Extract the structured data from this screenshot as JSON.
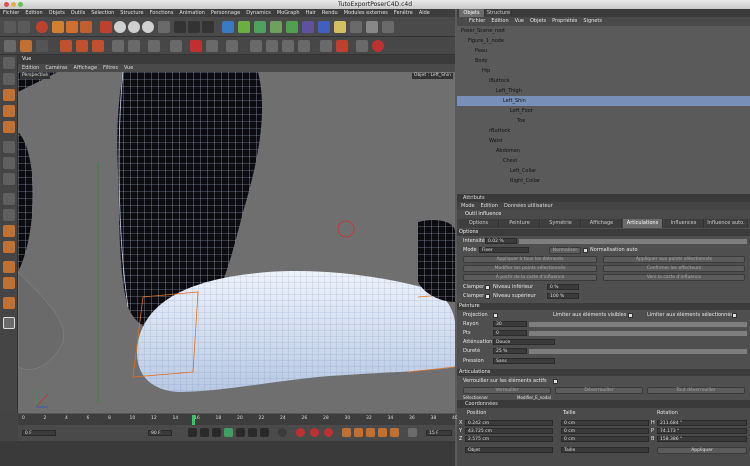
{
  "window": {
    "title": "TutoExportPoserC4D.c4d"
  },
  "menubar": [
    "Fichier",
    "Edition",
    "Objets",
    "Outils",
    "Sélection",
    "Structure",
    "Fonctions",
    "Animation",
    "Personnage",
    "Dynamics",
    "MoGraph",
    "Hair",
    "Rendu",
    "Modules externes",
    "Fenêtre",
    "Aide"
  ],
  "viewport": {
    "panel_title": "Vue",
    "menu": [
      "Edition",
      "Caméras",
      "Affichage",
      "Filtres",
      "Vue"
    ],
    "camera_label": "Perspective",
    "object_tag": "Objet : Left_Shin"
  },
  "timeline": {
    "ticks": [
      "0",
      "2",
      "4",
      "6",
      "8",
      "10",
      "12",
      "14",
      "16",
      "18",
      "20",
      "22",
      "24",
      "26",
      "28",
      "30",
      "32",
      "34",
      "36",
      "38",
      "40"
    ]
  },
  "playbar": {
    "start": "0 F",
    "end": "90 F",
    "current": "15 F"
  },
  "objects": {
    "tabs": [
      "Objets",
      "Structure"
    ],
    "menu": [
      "Fichier",
      "Edition",
      "Vue",
      "Objets",
      "Propriétés",
      "Signets"
    ],
    "tree": [
      {
        "name": "Poser_Scene_root",
        "indent": 0
      },
      {
        "name": "Figure_1_node",
        "indent": 1
      },
      {
        "name": "Peau",
        "indent": 2
      },
      {
        "name": "Body",
        "indent": 2
      },
      {
        "name": "Hip",
        "indent": 3
      },
      {
        "name": "lButtock",
        "indent": 4
      },
      {
        "name": "Left_Thigh",
        "indent": 5
      },
      {
        "name": "Left_Shin",
        "indent": 6
      },
      {
        "name": "Left_Foot",
        "indent": 7
      },
      {
        "name": "Toe",
        "indent": 8
      },
      {
        "name": "rButtock",
        "indent": 4
      },
      {
        "name": "Waist",
        "indent": 4
      },
      {
        "name": "Abdomen",
        "indent": 5
      },
      {
        "name": "Chest",
        "indent": 6
      },
      {
        "name": "Left_Collar",
        "indent": 7
      },
      {
        "name": "Right_Collar",
        "indent": 7
      }
    ]
  },
  "attributes": {
    "header": "Attributs",
    "menu": [
      "Mode",
      "Edition",
      "Données utilisateur"
    ],
    "title": "Outil influence",
    "tabs": [
      "Options",
      "Peinture",
      "Symétrie",
      "Affichage",
      "Articulations",
      "Influences",
      "Influence auto."
    ],
    "active_tab": "Articulations",
    "section_options": "Options",
    "intensity_label": "Intensité",
    "intensity_value": "0.02 %",
    "mode_label": "Mode",
    "mode_value": "Fixer",
    "normalize_btn": "Normaliser",
    "normalize_auto": "Normalisation auto",
    "btn_apply_all": "Appliquer à tous les éléments",
    "btn_apply_sel": "Appliquer aux points sélectionnés",
    "btn_modify": "Modifier les points sélectionnés",
    "btn_confirm": "Confirmer les effecteurs",
    "btn_from_map": "À partir de la carte d'influence",
    "btn_to_map": "Vers la carte d'influence",
    "clamp1_label": "Clamper",
    "clamp1_sub": "Niveau inférieur",
    "clamp1_value": "0 %",
    "clamp2_label": "Clamper",
    "clamp2_sub": "Niveau supérieur",
    "clamp2_value": "100 %",
    "section_paint": "Peinture",
    "projection_label": "Projection",
    "limit_visible": "Limiter aux éléments visibles",
    "limit_selected": "Limiter aux éléments sélectionnés",
    "rayon_label": "Rayon",
    "rayon_value": "30",
    "pts_label": "Pts",
    "pts_value": "0",
    "atten_label": "Atténuation",
    "atten_value": "Douce",
    "durete_label": "Dureté",
    "durete_value": "25 %",
    "pression_label": "Pression",
    "pression_value": "Sans",
    "section_joints": "Articulations",
    "lock_label": "Verrouiller sur les éléments actifs",
    "btn_lock": "Verrouiller",
    "btn_unlock": "Déverrouiller",
    "btn_unlock_all": "Tout déverrouiller",
    "selected_label": "Sélectionner",
    "selected_value": "Modifier_E_nodal"
  },
  "coordinates": {
    "header": "Coordonnées",
    "col_pos": "Position",
    "col_size": "Taille",
    "col_rot": "Rotation",
    "rows": [
      {
        "axis": "X",
        "pos": "0.242 cm",
        "size": "0 cm",
        "rot_axis": "H",
        "rot": "211.684 °"
      },
      {
        "axis": "Y",
        "pos": "43.725 cm",
        "size": "0 cm",
        "rot_axis": "P",
        "rot": "74.173 °"
      },
      {
        "axis": "Z",
        "pos": "2.575 cm",
        "size": "0 cm",
        "rot_axis": "B",
        "rot": "158.386 °"
      }
    ],
    "mode_value": "Objet",
    "size_mode": "Taille",
    "apply_button": "Appliquer"
  },
  "colors": {
    "accent": "#e07020",
    "mesh": "#dde8f8",
    "selected_row": "#7890b8"
  }
}
